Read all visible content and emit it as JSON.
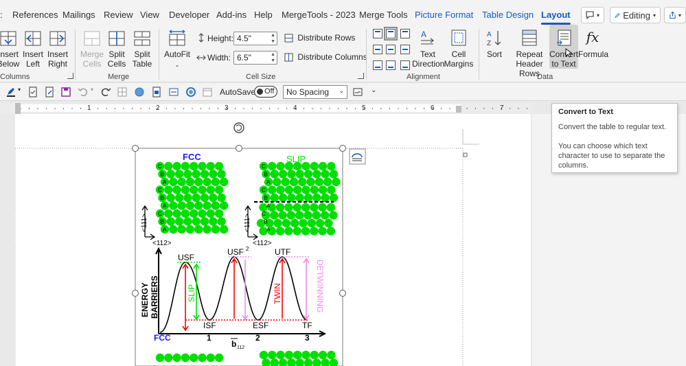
{
  "tabs": [
    "References",
    "Mailings",
    "Review",
    "View",
    "Developer",
    "Add-ins",
    "Help",
    "MergeTools - 2023",
    "Merge Tools",
    "Picture Format",
    "Table Design",
    "Layout"
  ],
  "right_controls": {
    "editing": "Editing"
  },
  "ribbon": {
    "insert_below": [
      "Insert",
      "Below"
    ],
    "insert_left": [
      "Insert",
      "Left"
    ],
    "insert_right": [
      "Insert",
      "Right"
    ],
    "columns_label": "Columns",
    "merge_cells": [
      "Merge",
      "Cells"
    ],
    "split_cells": [
      "Split",
      "Cells"
    ],
    "split_table": [
      "Split",
      "Table"
    ],
    "merge_label": "Merge",
    "autofit": "AutoFit",
    "height_label": "Height:",
    "height_value": "4.5\"",
    "width_label": "Width:",
    "width_value": "6.5\"",
    "distribute_rows": "Distribute Rows",
    "distribute_columns": "Distribute Columns",
    "cell_size_label": "Cell Size",
    "text_direction": [
      "Text",
      "Direction"
    ],
    "cell_margins": [
      "Cell",
      "Margins"
    ],
    "alignment_label": "Alignment",
    "sort": "Sort",
    "repeat_header_rows": [
      "Repeat",
      "Header Rows"
    ],
    "convert_to_text": [
      "Convert",
      "to Text"
    ],
    "formula": "Formula",
    "data_label": "Data"
  },
  "qat": {
    "autosave": "AutoSave",
    "autosave_state": "Off",
    "style": "No Spacing"
  },
  "ruler": [
    "1",
    "2",
    "3",
    "4",
    "5",
    "6",
    "7"
  ],
  "tooltip": {
    "title": "Convert to Text",
    "line1": "Convert the table to regular text.",
    "line2": "You can choose which text character to use to separate the columns."
  },
  "figure": {
    "fcc": "FCC",
    "slip": "SLIP",
    "stack_labels": [
      "C",
      "B",
      "A",
      "C",
      "B",
      "A",
      "C",
      "B",
      "A"
    ],
    "axis_111": "<111>",
    "axis_112": "<112>",
    "energy": "ENERGY",
    "barriers": "BARRIERS",
    "usf": "USF",
    "usf2": "USF",
    "utf": "UTF",
    "isf": "ISF",
    "esf": "ESF",
    "tf": "TF",
    "slip_v": "SLIP",
    "twin_v": "TWIN",
    "detwinning": "DETWINNING",
    "x_fcc": "FCC",
    "x1": "1",
    "x2": "2",
    "x3": "3",
    "b112": "b",
    "colors": {
      "green": "#00e000",
      "red": "#ff0000",
      "blue": "#1a1aff",
      "pink": "#f08ce8"
    }
  }
}
